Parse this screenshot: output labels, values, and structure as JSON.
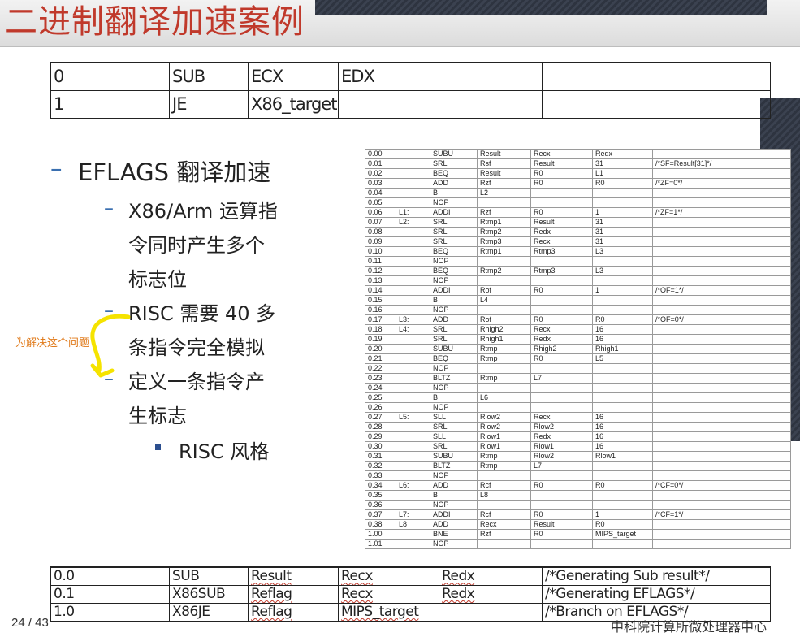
{
  "header": {
    "title": "二进制翻译加速案例"
  },
  "top_table": {
    "rows": [
      [
        "0",
        "",
        "SUB",
        "ECX",
        "EDX",
        "",
        ""
      ],
      [
        "1",
        "",
        "JE",
        "X86_target",
        "",
        "",
        ""
      ]
    ]
  },
  "bullets": {
    "level1": "EFLAGS 翻译加速",
    "sub1": [
      "X86/Arm 运算指",
      "令同时产生多个",
      "标志位"
    ],
    "sub2": [
      "RISC 需要 40 多",
      "条指令完全模拟"
    ],
    "sub3": [
      "定义一条指令产",
      "生标志"
    ],
    "level3": "RISC 风格"
  },
  "annotation": "为解决这个问题",
  "asm_table": {
    "rows": [
      [
        "0.00",
        "",
        "SUBU",
        "Result",
        "Recx",
        "Redx",
        ""
      ],
      [
        "0.01",
        "",
        "SRL",
        "Rsf",
        "Result",
        "31",
        "/*SF=Result[31]*/"
      ],
      [
        "0.02",
        "",
        "BEQ",
        "Result",
        "R0",
        "L1",
        ""
      ],
      [
        "0.03",
        "",
        "ADD",
        "Rzf",
        "R0",
        "R0",
        "/*ZF=0*/"
      ],
      [
        "0.04",
        "",
        "B",
        "L2",
        "",
        "",
        ""
      ],
      [
        "0.05",
        "",
        "NOP",
        "",
        "",
        "",
        ""
      ],
      [
        "0.06",
        "L1:",
        "ADDI",
        "Rzf",
        "R0",
        "1",
        "/*ZF=1*/"
      ],
      [
        "0.07",
        "L2:",
        "SRL",
        "Rtmp1",
        "Result",
        "31",
        ""
      ],
      [
        "0.08",
        "",
        "SRL",
        "Rtmp2",
        "Redx",
        "31",
        ""
      ],
      [
        "0.09",
        "",
        "SRL",
        "Rtmp3",
        "Recx",
        "31",
        ""
      ],
      [
        "0.10",
        "",
        "BEQ",
        "Rtmp1",
        "Rtmp3",
        "L3",
        ""
      ],
      [
        "0.11",
        "",
        "NOP",
        "",
        "",
        "",
        ""
      ],
      [
        "0.12",
        "",
        "BEQ",
        "Rtmp2",
        "Rtmp3",
        "L3",
        ""
      ],
      [
        "0.13",
        "",
        "NOP",
        "",
        "",
        "",
        ""
      ],
      [
        "0.14",
        "",
        "ADDI",
        "Rof",
        "R0",
        "1",
        "/*OF=1*/"
      ],
      [
        "0.15",
        "",
        "B",
        "L4",
        "",
        "",
        ""
      ],
      [
        "0.16",
        "",
        "NOP",
        "",
        "",
        "",
        ""
      ],
      [
        "0.17",
        "L3:",
        "ADD",
        "Rof",
        "R0",
        "R0",
        "/*OF=0*/"
      ],
      [
        "0.18",
        "L4:",
        "SRL",
        "Rhigh2",
        "Recx",
        "16",
        ""
      ],
      [
        "0.19",
        "",
        "SRL",
        "Rhigh1",
        "Redx",
        "16",
        ""
      ],
      [
        "0.20",
        "",
        "SUBU",
        "Rtmp",
        "Rhigh2",
        "Rhigh1",
        ""
      ],
      [
        "0.21",
        "",
        "BEQ",
        "Rtmp",
        "R0",
        "L5",
        ""
      ],
      [
        "0.22",
        "",
        "NOP",
        "",
        "",
        "",
        ""
      ],
      [
        "0.23",
        "",
        "BLTZ",
        "Rtmp",
        "L7",
        "",
        ""
      ],
      [
        "0.24",
        "",
        "NOP",
        "",
        "",
        "",
        ""
      ],
      [
        "0.25",
        "",
        "B",
        "L6",
        "",
        "",
        ""
      ],
      [
        "0.26",
        "",
        "NOP",
        "",
        "",
        "",
        ""
      ],
      [
        "0.27",
        "L5:",
        "SLL",
        "Rlow2",
        "Recx",
        "16",
        ""
      ],
      [
        "0.28",
        "",
        "SRL",
        "Rlow2",
        "Rlow2",
        "16",
        ""
      ],
      [
        "0.29",
        "",
        "SLL",
        "Rlow1",
        "Redx",
        "16",
        ""
      ],
      [
        "0.30",
        "",
        "SRL",
        "Rlow1",
        "Rlow1",
        "16",
        ""
      ],
      [
        "0.31",
        "",
        "SUBU",
        "Rtmp",
        "Rlow2",
        "Rlow1",
        ""
      ],
      [
        "0.32",
        "",
        "BLTZ",
        "Rtmp",
        "L7",
        "",
        ""
      ],
      [
        "0.33",
        "",
        "NOP",
        "",
        "",
        "",
        ""
      ],
      [
        "0.34",
        "L6:",
        "ADD",
        "Rcf",
        "R0",
        "R0",
        "/*CF=0*/"
      ],
      [
        "0.35",
        "",
        "B",
        "L8",
        "",
        "",
        ""
      ],
      [
        "0.36",
        "",
        "NOP",
        "",
        "",
        "",
        ""
      ],
      [
        "0.37",
        "L7:",
        "ADDI",
        "Rcf",
        "R0",
        "1",
        "/*CF=1*/"
      ],
      [
        "0.38",
        "L8",
        "ADD",
        "Recx",
        "Result",
        "R0",
        ""
      ],
      [
        "1.00",
        "",
        "BNE",
        "Rzf",
        "R0",
        "MIPS_target",
        ""
      ],
      [
        "1.01",
        "",
        "NOP",
        "",
        "",
        "",
        ""
      ]
    ]
  },
  "bottom_table": {
    "rows": [
      [
        "0.0",
        "",
        "SUB",
        "Result",
        "Recx",
        "Redx",
        "/*Generating Sub result*/"
      ],
      [
        "0.1",
        "",
        "X86SUB",
        "Reflag",
        "Recx",
        "Redx",
        "/*Generating EFLAGS*/"
      ],
      [
        "1.0",
        "",
        "X86JE",
        "Reflag",
        "MIPS_target",
        "",
        "/*Branch on EFLAGS*/"
      ]
    ]
  },
  "footer": {
    "page": "24 / 43",
    "org": "中科院计算所微处理器中心"
  }
}
